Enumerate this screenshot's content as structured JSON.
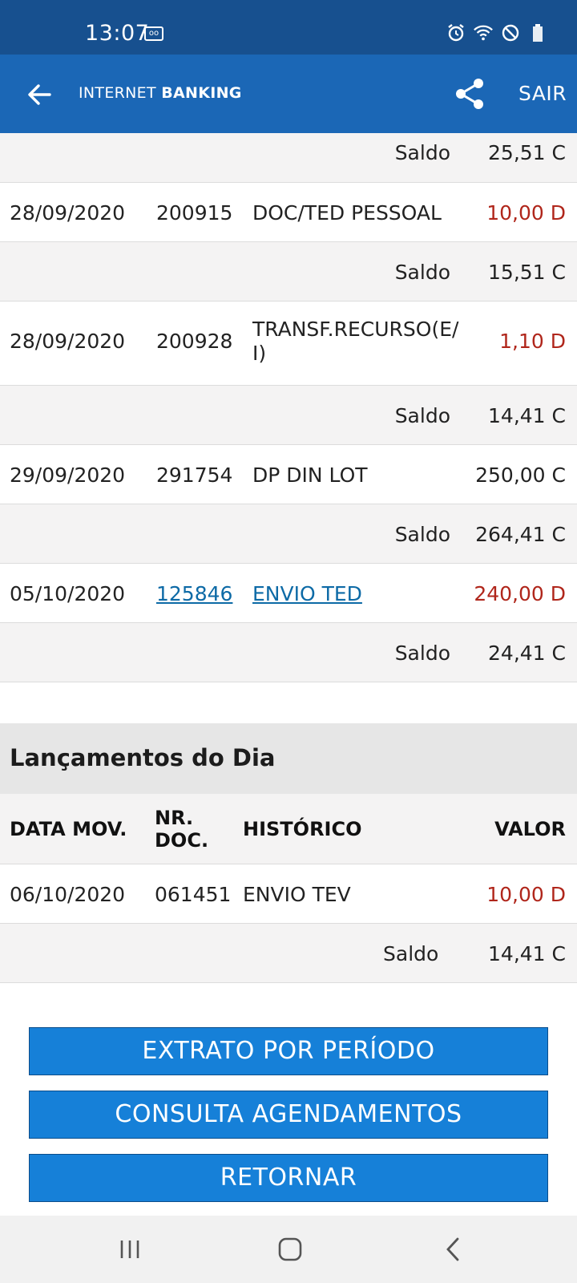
{
  "status_bar": {
    "time": "13:07"
  },
  "app_bar": {
    "title_light": "INTERNET ",
    "title_bold": "BANKING",
    "sair": "SAIR"
  },
  "statement": {
    "saldo_label": "Saldo",
    "rows": [
      {
        "type": "saldo",
        "value": "25,51 C"
      },
      {
        "type": "mov",
        "date": "28/09/2020",
        "doc": "200915",
        "hist": "DOC/TED PESSOAL",
        "value": "10,00 D"
      },
      {
        "type": "saldo",
        "value": "15,51 C"
      },
      {
        "type": "mov",
        "date": "28/09/2020",
        "doc": "200928",
        "hist": "TRANSF.RECURSO(E/ I)",
        "value": "1,10 D"
      },
      {
        "type": "saldo",
        "value": "14,41 C"
      },
      {
        "type": "mov",
        "date": "29/09/2020",
        "doc": "291754",
        "hist": "DP DIN LOT",
        "value": "250,00 C"
      },
      {
        "type": "saldo",
        "value": "264,41 C"
      },
      {
        "type": "mov",
        "date": "05/10/2020",
        "doc": "125846",
        "hist": "ENVIO TED",
        "value": "240,00 D"
      },
      {
        "type": "saldo",
        "value": "24,41 C"
      }
    ]
  },
  "day_section": {
    "title": "Lançamentos do Dia",
    "headers": {
      "date": "DATA MOV.",
      "doc_line1": "NR.",
      "doc_line2": "DOC.",
      "hist": "HISTÓRICO",
      "value": "VALOR"
    },
    "row": {
      "date": "06/10/2020",
      "doc": "061451",
      "hist": "ENVIO TEV",
      "value": "10,00 D"
    },
    "saldo_label": "Saldo",
    "saldo_value": "14,41 C"
  },
  "buttons": {
    "extrato": "EXTRATO POR PERÍODO",
    "agendamentos": "CONSULTA AGENDAMENTOS",
    "retornar": "RETORNAR"
  },
  "colors": {
    "status_bar": "#17508f",
    "app_bar": "#1b67b6",
    "button": "#1680d8",
    "debit": "#b0261b",
    "link": "#0d6aa6"
  }
}
